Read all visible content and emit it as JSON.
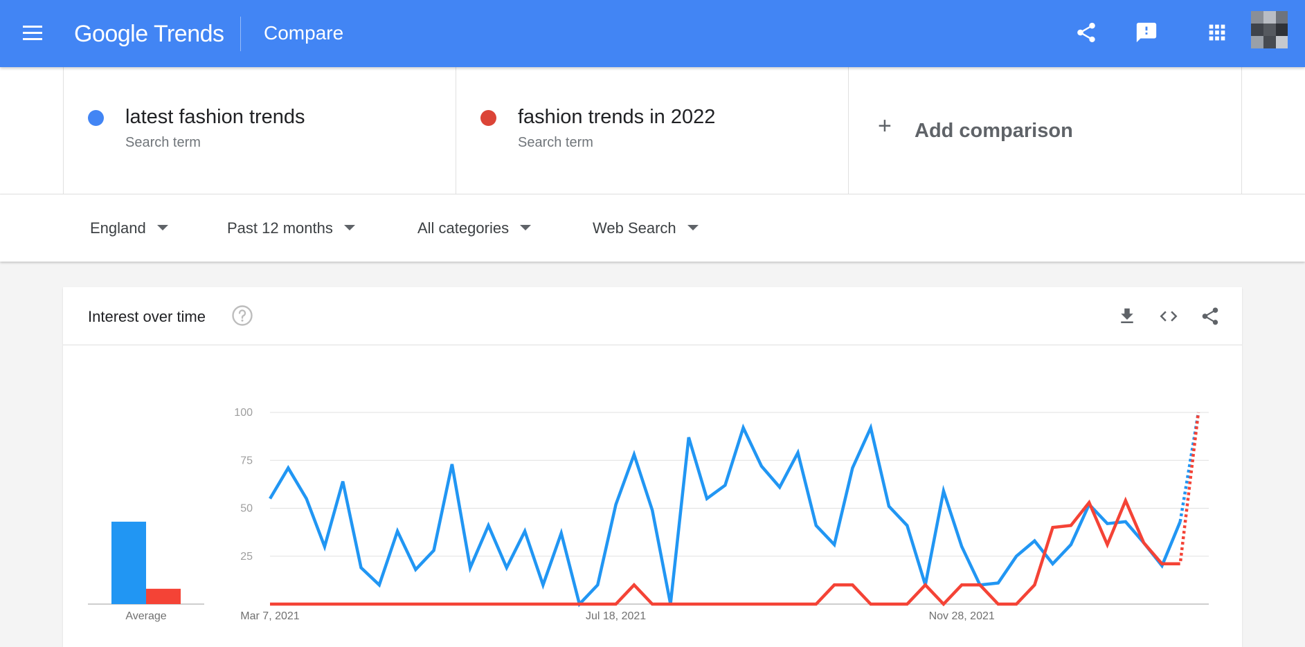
{
  "header": {
    "brand": "Google Trends",
    "page_title": "Compare",
    "icons": [
      "menu-icon",
      "share-icon",
      "feedback-icon",
      "apps-grid-icon",
      "avatar"
    ]
  },
  "terms": [
    {
      "name": "latest fashion trends",
      "type": "Search term",
      "color": "#4285f4"
    },
    {
      "name": "fashion trends in 2022",
      "type": "Search term",
      "color": "#db4437"
    }
  ],
  "add_comparison": {
    "label": "Add comparison"
  },
  "filters": {
    "region": "England",
    "time": "Past 12 months",
    "category": "All categories",
    "search_type": "Web Search"
  },
  "card": {
    "title": "Interest over time"
  },
  "colors": {
    "header_bg": "#4285f4",
    "series1": "#2196f3",
    "series2": "#f44336"
  },
  "chart_data": {
    "type": "line",
    "x_tick_labels": [
      "Mar 7, 2021",
      "Jul 18, 2021",
      "Nov 28, 2021"
    ],
    "ylim": [
      0,
      100
    ],
    "y_ticks": [
      25,
      50,
      75,
      100
    ],
    "grid": true,
    "average": {
      "label": "Average",
      "values": [
        43,
        8
      ]
    },
    "series": [
      {
        "name": "latest fashion trends",
        "color": "#2196f3",
        "values": [
          55,
          71,
          55,
          30,
          64,
          19,
          10,
          38,
          18,
          28,
          73,
          19,
          41,
          19,
          38,
          10,
          37,
          0,
          10,
          52,
          78,
          49,
          0,
          87,
          55,
          62,
          92,
          72,
          61,
          79,
          41,
          31,
          71,
          92,
          51,
          41,
          10,
          59,
          30,
          10,
          11,
          25,
          33,
          21,
          31,
          52,
          42,
          43,
          32,
          20,
          43,
          100
        ]
      },
      {
        "name": "fashion trends in 2022",
        "color": "#f44336",
        "values": [
          0,
          0,
          0,
          0,
          0,
          0,
          0,
          0,
          0,
          0,
          0,
          0,
          0,
          0,
          0,
          0,
          0,
          0,
          0,
          0,
          10,
          0,
          0,
          0,
          0,
          0,
          0,
          0,
          0,
          0,
          0,
          10,
          10,
          0,
          0,
          0,
          10,
          0,
          10,
          10,
          0,
          0,
          10,
          40,
          41,
          53,
          31,
          54,
          32,
          21,
          21,
          100
        ]
      }
    ],
    "partial_last_point": true
  }
}
